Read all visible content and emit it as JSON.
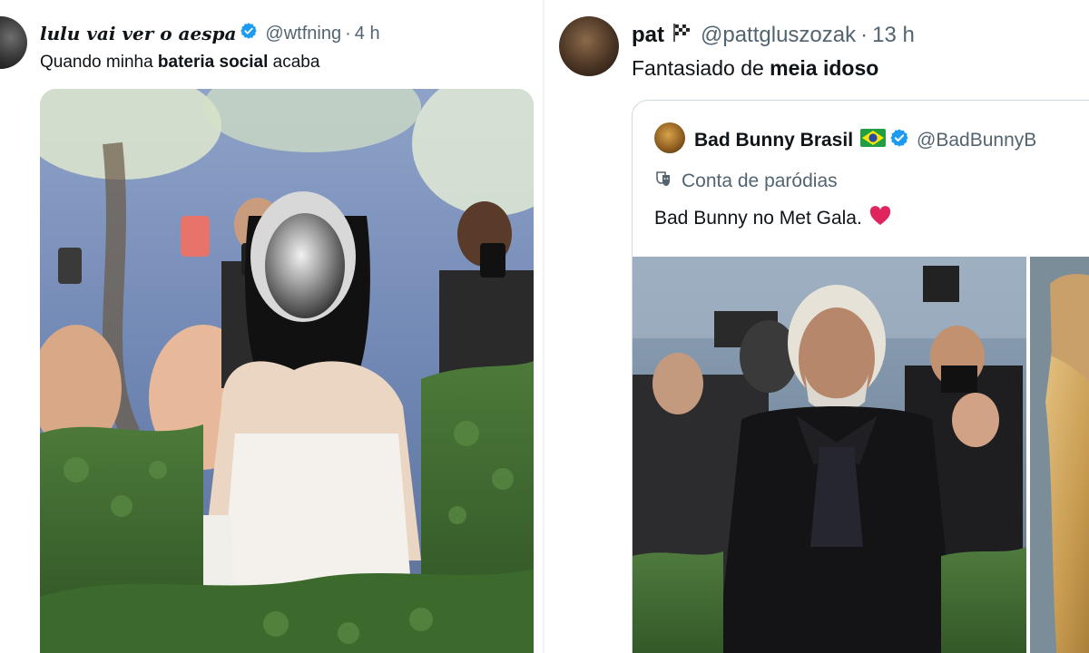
{
  "left_tweet": {
    "display_name": "lulu vai ver o aespa",
    "handle": "@wtfning",
    "separator": "·",
    "time": "4 h",
    "text_before": "Quando minha ",
    "text_bold": "bateria social",
    "text_after": " acaba"
  },
  "right_tweet": {
    "display_name": "pat",
    "name_emoji": "🏁",
    "handle": "@pattgluszozak",
    "separator": "·",
    "time": "13 h",
    "text_before": "Fantasiado de ",
    "text_bold": "meia idoso",
    "quote": {
      "display_name": "Bad Bunny Brasil",
      "handle": "@BadBunnyB",
      "label": "Conta de paródias",
      "text": "Bad Bunny no Met Gala."
    }
  },
  "colors": {
    "verified_blue": "#1d9bf0",
    "text_primary": "#0f1419",
    "text_secondary": "#536471",
    "heart_red": "#e0245e"
  },
  "icons": {
    "verified": "verified-badge-icon",
    "parody": "theater-masks-icon",
    "heart": "red-heart-icon",
    "flag": "brazil-flag-icon",
    "checkered_flag": "checkered-flag-icon"
  }
}
